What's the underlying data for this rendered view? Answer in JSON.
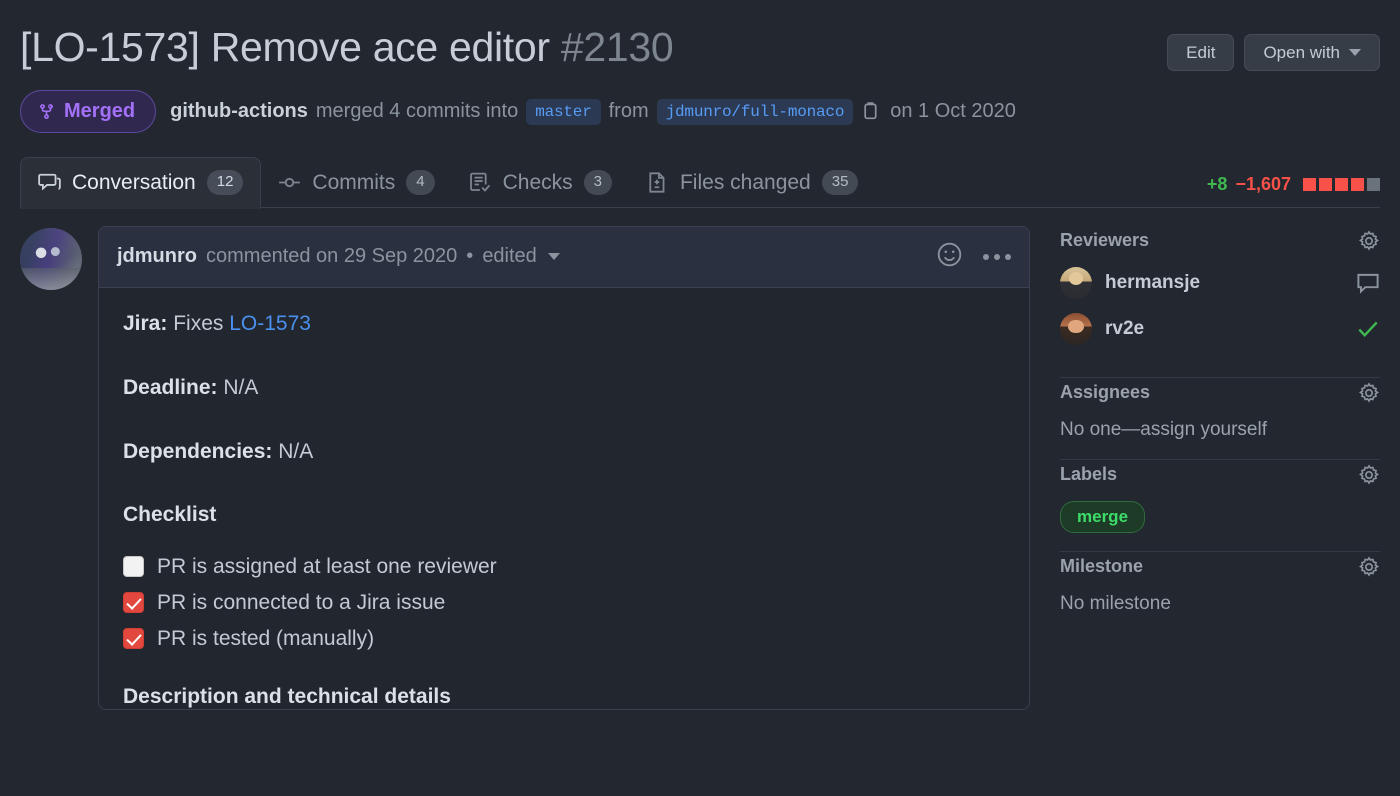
{
  "header": {
    "title": "[LO-1573] Remove ace editor",
    "number": "#2130",
    "edit_label": "Edit",
    "open_with_label": "Open with"
  },
  "status": {
    "merged_label": "Merged",
    "author": "github-actions",
    "verb": "merged 4 commits into",
    "base_branch": "master",
    "from_word": "from",
    "head_branch": "jdmunro/full-monaco",
    "date": "on 1 Oct 2020"
  },
  "tabs": [
    {
      "label": "Conversation",
      "count": "12",
      "icon": "comment-icon",
      "active": true
    },
    {
      "label": "Commits",
      "count": "4",
      "icon": "commit-icon",
      "active": false
    },
    {
      "label": "Checks",
      "count": "3",
      "icon": "checklist-icon",
      "active": false
    },
    {
      "label": "Files changed",
      "count": "35",
      "icon": "file-diff-icon",
      "active": false
    }
  ],
  "diffstat": {
    "additions": "+8",
    "deletions": "−1,607",
    "blocks": [
      "#f85149",
      "#f85149",
      "#f85149",
      "#f85149",
      "#6a727c"
    ]
  },
  "comment": {
    "author": "jdmunro",
    "action": "commented on 29 Sep 2020",
    "separator": "•",
    "edited": "edited",
    "body": {
      "jira_label": "Jira:",
      "jira_text": "Fixes",
      "jira_link": "LO-1573",
      "deadline_label": "Deadline:",
      "deadline_value": "N/A",
      "dependencies_label": "Dependencies:",
      "dependencies_value": "N/A",
      "checklist_heading": "Checklist",
      "tasks": [
        {
          "label": "PR is assigned at least one reviewer",
          "checked": false
        },
        {
          "label": "PR is connected to a Jira issue",
          "checked": true
        },
        {
          "label": "PR is tested (manually)",
          "checked": true
        }
      ],
      "description_heading": "Description and technical details"
    }
  },
  "sidebar": {
    "reviewers": {
      "title": "Reviewers",
      "items": [
        {
          "name": "hermansje",
          "status": "commented"
        },
        {
          "name": "rv2e",
          "status": "approved"
        }
      ]
    },
    "assignees": {
      "title": "Assignees",
      "value": "No one—assign yourself"
    },
    "labels": {
      "title": "Labels",
      "items": [
        "merge"
      ]
    },
    "milestone": {
      "title": "Milestone",
      "value": "No milestone"
    }
  }
}
